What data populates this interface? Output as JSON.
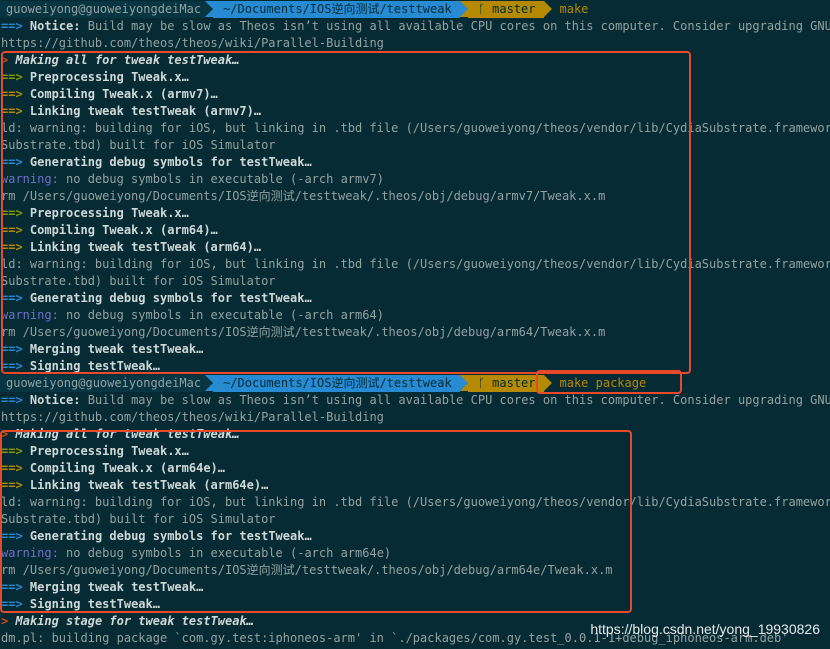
{
  "prompt": {
    "user_host": "guoweiyong@guoweiyongdeiMac",
    "path": "~/Documents/IOS逆向测试/testtweak",
    "branch_icon": "git-branch-icon",
    "branch": "master"
  },
  "commands": [
    "make",
    "make package"
  ],
  "lines": [
    "Notice: Build may be slow as Theos isn’t using all available CPU cores on this computer. Consider upgrading GNU Make",
    "https://github.com/theos/theos/wiki/Parallel-Building",
    "Making all for tweak testTweak…",
    "Preprocessing Tweak.x…",
    "Compiling Tweak.x (armv7)…",
    "Linking tweak testTweak (armv7)…",
    "ld: warning: building for iOS, but linking in .tbd file (/Users/guoweiyong/theos/vendor/lib/CydiaSubstrate.framework/Cy",
    "Substrate.tbd) built for iOS Simulator",
    "Generating debug symbols for testTweak…",
    "warning:",
    "no debug symbols in executable (-arch armv7)",
    "rm /Users/guoweiyong/Documents/IOS逆向测试/testtweak/.theos/obj/debug/armv7/Tweak.x.m",
    "Preprocessing Tweak.x…",
    "Compiling Tweak.x (arm64)…",
    "Linking tweak testTweak (arm64)…",
    "ld: warning: building for iOS, but linking in .tbd file (/Users/guoweiyong/theos/vendor/lib/CydiaSubstrate.framework/Cy",
    "Substrate.tbd) built for iOS Simulator",
    "Generating debug symbols for testTweak…",
    "no debug symbols in executable (-arch arm64)",
    "rm /Users/guoweiyong/Documents/IOS逆向测试/testtweak/.theos/obj/debug/arm64/Tweak.x.m",
    "Merging tweak testTweak…",
    "Signing testTweak…",
    "Notice: Build may be slow as Theos isn’t using all available CPU cores on this computer. Consider upgrading GNU Make",
    "https://github.com/theos/theos/wiki/Parallel-Building",
    "Making all for tweak testTweak…",
    "Preprocessing Tweak.x…",
    "Compiling Tweak.x (arm64e)…",
    "Linking tweak testTweak (arm64e)…",
    "ld: warning: building for iOS, but linking in .tbd file (/Users/guoweiyong/theos/vendor/lib/CydiaSubstrate.framework/Cy",
    "Substrate.tbd) built for iOS Simulator",
    "Generating debug symbols for testTweak…",
    "no debug symbols in executable (-arch arm64e)",
    "rm /Users/guoweiyong/Documents/IOS逆向测试/testtweak/.theos/obj/debug/arm64e/Tweak.x.m",
    "Merging tweak testTweak…",
    "Signing testTweak…",
    "Making stage for tweak testTweak…",
    "dm.pl: building package `com.gy.test:iphoneos-arm' in `./packages/com.gy.test_0.0.1-1+debug_iphoneos-arm.deb'"
  ],
  "arrow": "==>",
  "arrow_single": ">",
  "watermark": "https://blog.csdn.net/yong_19930826",
  "colors": {
    "highlight_box": "#e8492a",
    "background": "#072b35"
  }
}
